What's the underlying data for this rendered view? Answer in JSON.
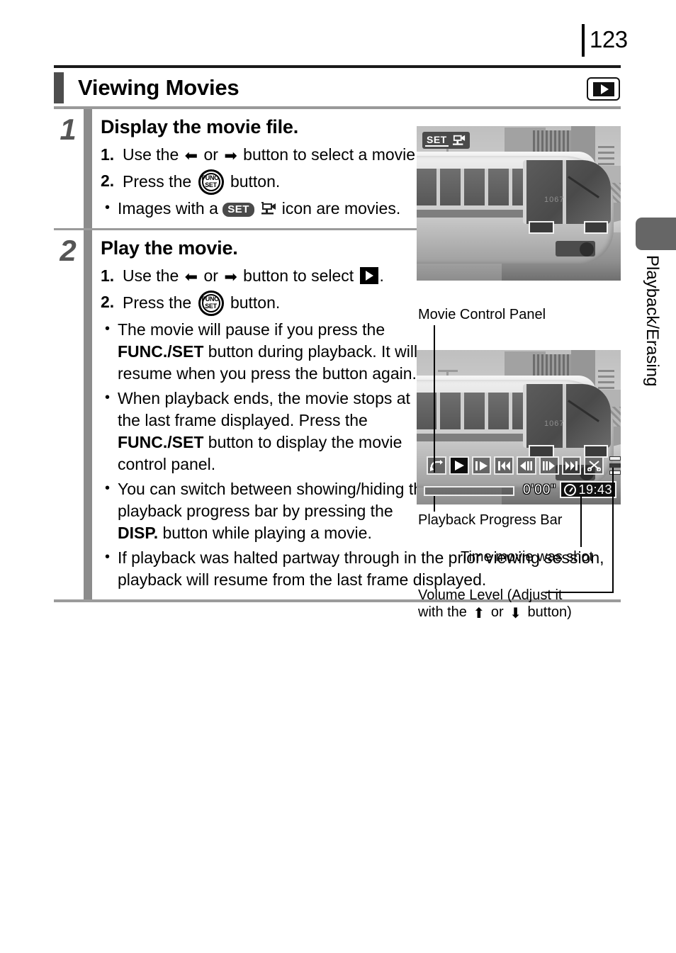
{
  "page": {
    "number": "123",
    "side_tab_label": "Playback/Erasing"
  },
  "header": {
    "title": "Viewing Movies",
    "mode_icon": "playback-mode-icon"
  },
  "steps": [
    {
      "number": "1",
      "heading": "Display the movie file.",
      "substeps": [
        {
          "num": "1.",
          "text_before": "Use the",
          "text_mid": "or",
          "text_after": "button to select a movie."
        },
        {
          "num": "2.",
          "text_before": "Press the",
          "text_after": "button."
        }
      ],
      "bullets": [
        {
          "before": "Images with a",
          "after": "icon are movies."
        }
      ]
    },
    {
      "number": "2",
      "heading": "Play the movie.",
      "substeps": [
        {
          "num": "1.",
          "text_before": "Use the",
          "text_mid": "or",
          "text_after": "button to select"
        },
        {
          "num": "2.",
          "text_before": "Press the",
          "text_after": "button."
        }
      ],
      "bullets": [
        {
          "part1": "The movie will pause if you press the ",
          "bold1": "FUNC./SET",
          "part2": " button during playback. It will resume when you press the button again."
        },
        {
          "part1": "When playback ends, the movie stops at the last frame displayed. Press the ",
          "bold1": "FUNC./SET",
          "part2": " button to display the movie control panel."
        },
        {
          "part1": "You can switch between showing/hiding the playback progress bar by pressing the ",
          "bold1": "DISP.",
          "part2": " button while playing a movie."
        },
        {
          "part1": "If playback was halted partway through in the prior viewing session, playback will resume from the last frame displayed.",
          "bold1": "",
          "part2": ""
        }
      ]
    }
  ],
  "photo1": {
    "overlay_set_label": "SET",
    "overlay_icon": "movie-camera-icon",
    "alt": "grayscale photo of a monorail train"
  },
  "photo2": {
    "alt": "grayscale photo of a monorail train with movie control panel overlay",
    "control_panel": {
      "buttons": [
        {
          "name": "exit-button",
          "glyph": "exit-arrow-icon",
          "selected": false
        },
        {
          "name": "play-button",
          "glyph": "play-icon",
          "selected": true
        },
        {
          "name": "slow-motion-button",
          "glyph": "slow-motion-icon",
          "selected": false
        },
        {
          "name": "first-frame-button",
          "glyph": "skip-to-start-icon",
          "selected": false
        },
        {
          "name": "previous-frame-button",
          "glyph": "step-back-icon",
          "selected": false
        },
        {
          "name": "next-frame-button",
          "glyph": "step-forward-icon",
          "selected": false
        },
        {
          "name": "last-frame-button",
          "glyph": "skip-to-end-icon",
          "selected": false
        },
        {
          "name": "edit-button",
          "glyph": "scissors-icon",
          "selected": false
        }
      ],
      "volume_name": "volume-level-indicator",
      "elapsed_time": "0'00\"",
      "shot_time": "19:43",
      "clock_icon": "clock-icon"
    }
  },
  "callouts": {
    "movie_control_panel": "Movie Control Panel",
    "playback_progress_bar": "Playback Progress Bar",
    "time_movie_was_shot": "Time movie was shot",
    "volume_level_line1": "Volume Level (Adjust it",
    "volume_level_line2_before": "with the",
    "volume_level_line2_mid": "or",
    "volume_level_line2_after": "button)"
  },
  "colors": {
    "accent_gray": "#8c8c8c",
    "title_accent": "#4d4d4d",
    "side_tab": "#666666",
    "rule": "#9b9b9b"
  }
}
